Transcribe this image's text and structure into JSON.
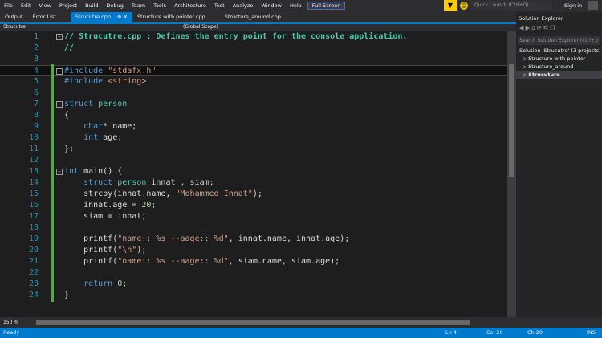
{
  "menu": [
    "File",
    "Edit",
    "View",
    "Project",
    "Build",
    "Debug",
    "Team",
    "Tools",
    "Architecture",
    "Test",
    "Analyze",
    "Window",
    "Help"
  ],
  "full_screen": "Full Screen",
  "quick_launch": "Quick Launch (Ctrl+Q)",
  "sign_in": "Sign in",
  "tabs": [
    "Output",
    "Error List",
    "Strucutre.cpp",
    "Structure with pointer.cpp",
    "Structure_around.cpp"
  ],
  "active_tab_suffix": "⊕ ✕",
  "nav": {
    "project": "Strucutre",
    "scope": "(Global Scope)"
  },
  "code": [
    [
      [
        "// Strucutre.cpp : Defines the entry point for the console application.",
        "cmh"
      ]
    ],
    [
      [
        "//",
        "cmh"
      ]
    ],
    [],
    [
      [
        "#include ",
        "kw"
      ],
      [
        "\"stdafx.h\"",
        "st"
      ]
    ],
    [
      [
        "#include ",
        "kw"
      ],
      [
        "<string>",
        "st"
      ]
    ],
    [],
    [
      [
        "struct ",
        "kw"
      ],
      [
        "person",
        "ty"
      ]
    ],
    [
      [
        "{",
        ""
      ]
    ],
    [
      [
        "    char",
        "kw"
      ],
      [
        "* name;",
        ""
      ]
    ],
    [
      [
        "    int",
        "kw"
      ],
      [
        " age;",
        ""
      ]
    ],
    [
      [
        "};",
        ""
      ]
    ],
    [],
    [
      [
        "int ",
        "kw"
      ],
      [
        "main() {",
        ""
      ]
    ],
    [
      [
        "    struct ",
        "kw"
      ],
      [
        "person ",
        "ty"
      ],
      [
        "innat , siam;",
        ""
      ]
    ],
    [
      [
        "    strcpy(innat.name, ",
        ""
      ],
      [
        "\"Mohammed Innat\"",
        "st"
      ],
      [
        ");",
        ""
      ]
    ],
    [
      [
        "    innat.age = ",
        ""
      ],
      [
        "20",
        "nu"
      ],
      [
        ";",
        ""
      ]
    ],
    [
      [
        "    siam = innat;",
        ""
      ]
    ],
    [],
    [
      [
        "    printf(",
        ""
      ],
      [
        "\"name:: %s --aage:: %d\"",
        "st"
      ],
      [
        ", innat.name, innat.age);",
        ""
      ]
    ],
    [
      [
        "    printf(",
        ""
      ],
      [
        "\"\\n\"",
        "st"
      ],
      [
        ");",
        ""
      ]
    ],
    [
      [
        "    printf(",
        ""
      ],
      [
        "\"name:: %s --aage:: %d\"",
        "st"
      ],
      [
        ", siam.name, siam.age);",
        ""
      ]
    ],
    [],
    [
      [
        "    return ",
        "kw"
      ],
      [
        "0",
        "nu"
      ],
      [
        ";",
        ""
      ]
    ],
    [
      [
        "}",
        ""
      ]
    ]
  ],
  "folds": [
    1,
    4,
    7,
    13
  ],
  "current_line": 4,
  "zoom": "150 %",
  "solution_explorer": {
    "title": "Solution Explorer",
    "search": "Search Solution Explorer (Ctrl+;)",
    "solution": "Solution 'Strucutre' (3 projects)",
    "items": [
      "Structure with pointer",
      "Structure_around",
      "Strucuture"
    ]
  },
  "status": {
    "ready": "Ready",
    "ln": "Ln 4",
    "col": "Col 20",
    "ch": "Ch 20",
    "ins": "INS"
  }
}
